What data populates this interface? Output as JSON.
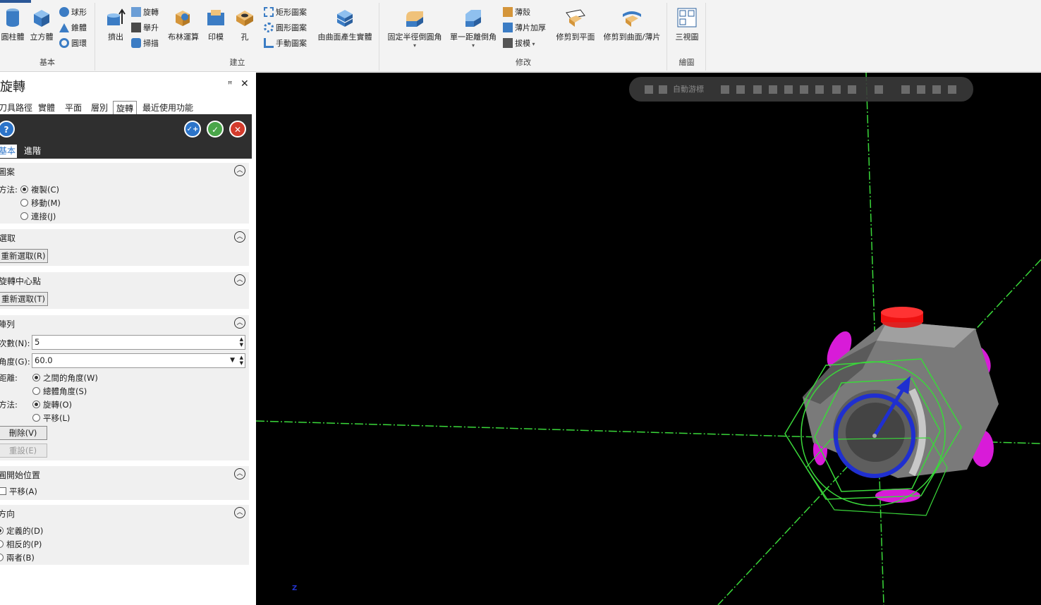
{
  "ribbon": {
    "basic": {
      "label": "基本",
      "cylinder": "圓柱體",
      "box": "立方體",
      "sphere": "球形",
      "cone": "錐體",
      "torus": "圓環"
    },
    "create": {
      "label": "建立",
      "extrude": "擠出",
      "revolve": "旋轉",
      "loft": "舉升",
      "sweep": "掃描",
      "boolean": "布林運算",
      "emboss": "印模",
      "hole": "孔",
      "rect_pattern": "矩形圖案",
      "circ_pattern": "圓形圖案",
      "manual_pattern": "手動圖案",
      "solid_from_surface": "由曲面產生實體"
    },
    "modify": {
      "label": "修改",
      "const_fillet": "固定半徑倒圓角",
      "chamfer": "單一距離倒角",
      "shell": "薄殼",
      "thicken": "薄片加厚",
      "draft": "拔模",
      "trim_plane": "修剪到平面",
      "trim_surface": "修剪到曲面/薄片"
    },
    "drawing": {
      "label": "繪圖",
      "three_view": "三視圖"
    }
  },
  "panel": {
    "title": "旋轉",
    "tabs": [
      "刀具路徑",
      "實體",
      "平面",
      "層別",
      "旋轉",
      "最近使用功能"
    ],
    "subtabs": [
      "基本",
      "進階"
    ],
    "pattern": {
      "header": "圖案",
      "method_label": "方法:",
      "options": [
        "複製(C)",
        "移動(M)",
        "連接(J)"
      ]
    },
    "select": {
      "header": "選取",
      "reselect": "重新選取(R)"
    },
    "center": {
      "header": "旋轉中心點",
      "reselect": "重新選取(T)"
    },
    "array": {
      "header": "陣列",
      "count_label": "次數(N):",
      "count": "5",
      "angle_label": "角度(G):",
      "angle": "60.0",
      "distance_label": "距離:",
      "distance_options": [
        "之間的角度(W)",
        "總體角度(S)"
      ],
      "method_label": "方法:",
      "method_options": [
        "旋轉(O)",
        "平移(L)"
      ],
      "delete": "刪除(V)",
      "reset": "重設(E)"
    },
    "start": {
      "header": "圓開始位置",
      "translate": "平移(A)"
    },
    "direction": {
      "header": "方向",
      "options": [
        "定義的(D)",
        "相反的(P)",
        "兩者(B)"
      ]
    }
  },
  "viewport": {
    "toolbar_label": "自動游標",
    "axis_label": "Z"
  }
}
